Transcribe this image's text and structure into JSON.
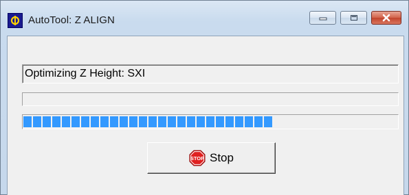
{
  "window": {
    "title": "AutoTool: Z ALIGN"
  },
  "status": {
    "message": "Optimizing Z Height: SXI"
  },
  "progress": {
    "percent": 67
  },
  "stop_button": {
    "label": "Stop",
    "icon_text": "STOP"
  },
  "colors": {
    "progress_fill": "#3399ff",
    "stop_icon": "#e02020",
    "close_button": "#c9452d"
  },
  "icons": {
    "app": "phi-logo-icon",
    "minimize": "minimize-icon",
    "maximize": "maximize-icon",
    "close": "close-icon",
    "stop": "stop-sign-icon"
  }
}
